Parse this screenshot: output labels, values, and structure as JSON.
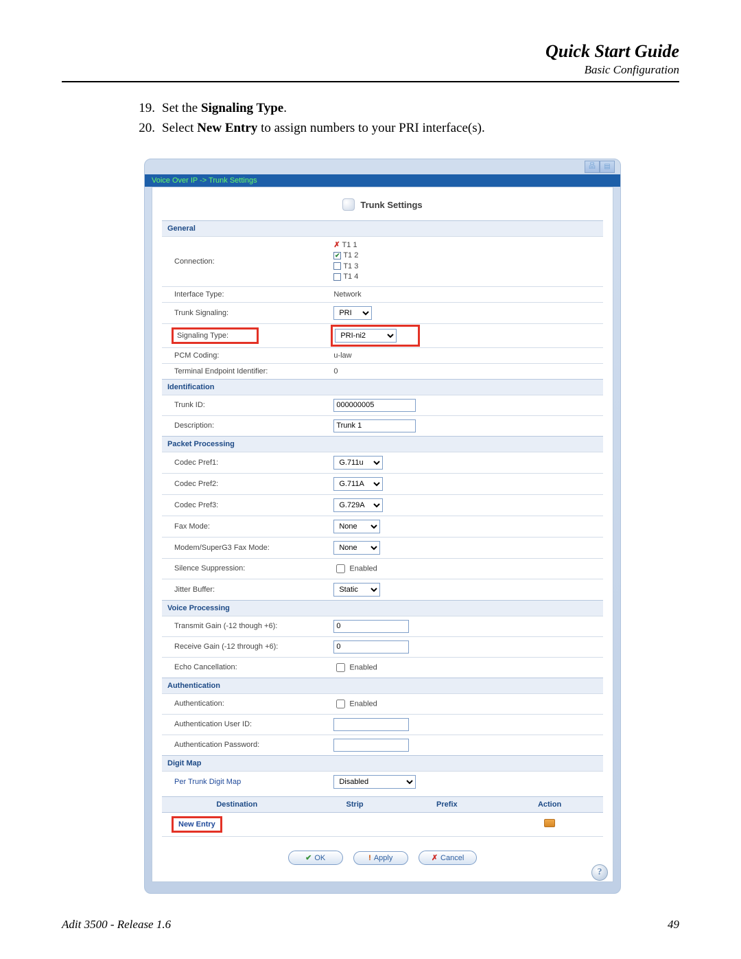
{
  "header": {
    "title": "Quick Start Guide",
    "subtitle": "Basic Configuration"
  },
  "instructions": [
    {
      "num": "19.",
      "pre": "Set the ",
      "bold": "Signaling Type",
      "post": "."
    },
    {
      "num": "20.",
      "pre": "Select ",
      "bold": "New Entry",
      "post": " to assign numbers to your PRI interface(s)."
    }
  ],
  "screenshot": {
    "breadcrumb": "Voice Over IP -> Trunk Settings",
    "panelTitle": "Trunk Settings",
    "sections": {
      "general": "General",
      "identification": "Identification",
      "packet": "Packet Processing",
      "voice": "Voice Processing",
      "auth": "Authentication",
      "digit": "Digit Map"
    },
    "labels": {
      "connection": "Connection:",
      "ifaceType": "Interface Type:",
      "trunkSignaling": "Trunk Signaling:",
      "signalingType": "Signaling Type:",
      "pcm": "PCM Coding:",
      "tei": "Terminal Endpoint Identifier:",
      "trunkId": "Trunk ID:",
      "desc": "Description:",
      "codec1": "Codec Pref1:",
      "codec2": "Codec Pref2:",
      "codec3": "Codec Pref3:",
      "fax": "Fax Mode:",
      "modemFax": "Modem/SuperG3 Fax Mode:",
      "silence": "Silence Suppression:",
      "jitter": "Jitter Buffer:",
      "txGain": "Transmit Gain (-12 though +6):",
      "rxGain": "Receive Gain (-12 through +6):",
      "echo": "Echo Cancellation:",
      "authEn": "Authentication:",
      "authUser": "Authentication User ID:",
      "authPass": "Authentication Password:",
      "perTrunk": "Per Trunk Digit Map"
    },
    "values": {
      "conn1": "T1 1",
      "conn2": "T1 2",
      "conn3": "T1 3",
      "conn4": "T1 4",
      "ifaceType": "Network",
      "trunkSignaling": "PRI",
      "signalingType": "PRI-ni2",
      "pcm": "u-law",
      "tei": "0",
      "trunkId": "000000005",
      "desc": "Trunk 1",
      "codec1": "G.711u",
      "codec2": "G.711A",
      "codec3": "G.729A",
      "fax": "None",
      "modemFax": "None",
      "enabledLabel": "Enabled",
      "jitter": "Static",
      "txGain": "0",
      "rxGain": "0",
      "perTrunk": "Disabled"
    },
    "tableHeaders": {
      "dest": "Destination",
      "strip": "Strip",
      "prefix": "Prefix",
      "action": "Action"
    },
    "newEntry": "New Entry",
    "buttons": {
      "ok": "OK",
      "apply": "Apply",
      "cancel": "Cancel"
    }
  },
  "footer": {
    "left": "Adit 3500  - Release 1.6",
    "right": "49"
  }
}
